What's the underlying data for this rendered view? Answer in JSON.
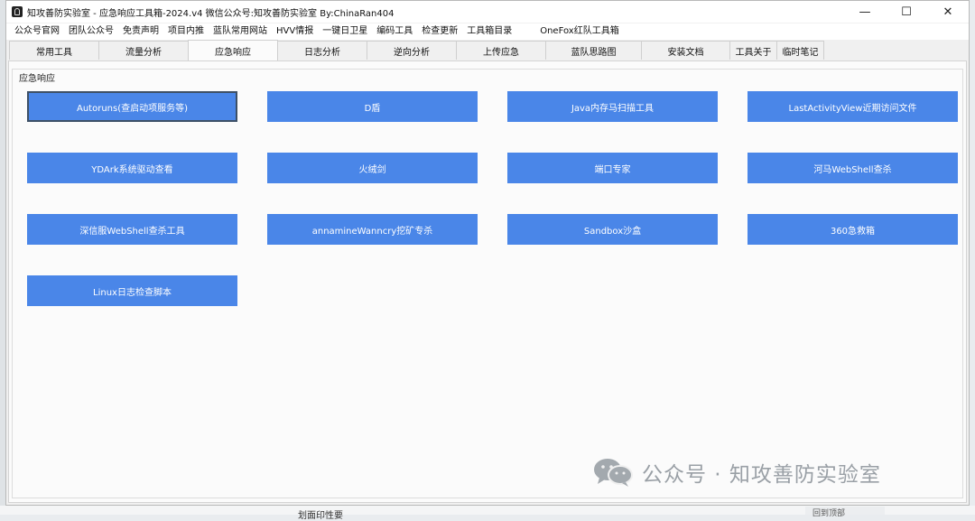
{
  "window": {
    "title": "知攻善防实验室 - 应急响应工具箱-2024.v4    微信公众号:知攻善防实验室   By:ChinaRan404",
    "controls": {
      "minimize": "—",
      "maximize": "☐",
      "close": "✕"
    }
  },
  "menu": [
    "公众号官网",
    "团队公众号",
    "免责声明",
    "项目内推",
    "蓝队常用网站",
    "HVV情报",
    "一键日卫星",
    "编码工具",
    "检查更新",
    "工具箱目录",
    "OneFox红队工具箱"
  ],
  "tabs": [
    {
      "label": "常用工具",
      "active": false
    },
    {
      "label": "流量分析",
      "active": false
    },
    {
      "label": "应急响应",
      "active": true
    },
    {
      "label": "日志分析",
      "active": false
    },
    {
      "label": "逆向分析",
      "active": false
    },
    {
      "label": "上传应急",
      "active": false
    },
    {
      "label": "蓝队思路图",
      "active": false
    },
    {
      "label": "安装文档",
      "active": false
    },
    {
      "label": "工具关于",
      "active": false
    },
    {
      "label": "临时笔记",
      "active": false
    }
  ],
  "group": {
    "label": "应急响应"
  },
  "buttons": [
    {
      "label": "Autoruns(查启动项服务等)",
      "focused": true
    },
    {
      "label": "D盾",
      "focused": false
    },
    {
      "label": "Java内存马扫描工具",
      "focused": false
    },
    {
      "label": "LastActivityView近期访问文件",
      "focused": false
    },
    {
      "label": "YDArk系统驱动查看",
      "focused": false
    },
    {
      "label": "火绒剑",
      "focused": false
    },
    {
      "label": "端口专家",
      "focused": false
    },
    {
      "label": "河马WebShell查杀",
      "focused": false
    },
    {
      "label": "深信服WebShell查杀工具",
      "focused": false
    },
    {
      "label": "annamineWanncry挖矿专杀",
      "focused": false
    },
    {
      "label": "Sandbox沙盒",
      "focused": false
    },
    {
      "label": "360急救箱",
      "focused": false
    },
    {
      "label": "Linux日志检查脚本",
      "focused": false
    }
  ],
  "colors": {
    "button_bg": "#4a86e8",
    "button_text": "#ffffff"
  },
  "watermark": {
    "text": "公众号 · 知攻善防实验室",
    "icon": "wechat-icon"
  },
  "background": {
    "partial_text": "划面印性要",
    "partial_button": "回到顶部"
  }
}
